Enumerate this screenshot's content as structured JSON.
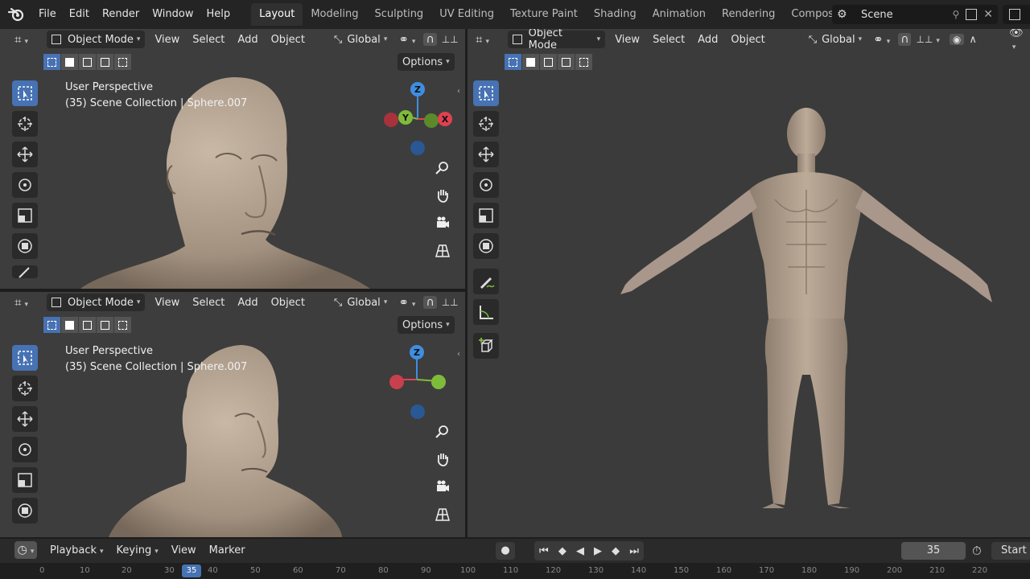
{
  "menubar": {
    "items": [
      "File",
      "Edit",
      "Render",
      "Window",
      "Help"
    ]
  },
  "workspaces": [
    "Layout",
    "Modeling",
    "Sculpting",
    "UV Editing",
    "Texture Paint",
    "Shading",
    "Animation",
    "Rendering",
    "Compositin"
  ],
  "active_workspace": "Layout",
  "scene": {
    "name": "Scene"
  },
  "viewport_header": {
    "mode": "Object Mode",
    "menus": [
      "View",
      "Select",
      "Add",
      "Object"
    ],
    "orientation": "Global",
    "options": "Options"
  },
  "viewports": [
    {
      "title": "User Perspective",
      "subtitle": "(35) Scene Collection | Sphere.007"
    },
    {
      "title": "User Perspective",
      "subtitle": "(35) Scene Collection | Sphere.007"
    }
  ],
  "gizmo": {
    "z": "Z",
    "y": "Y",
    "x": "X"
  },
  "timeline": {
    "menus": [
      "Playback",
      "Keying",
      "View",
      "Marker"
    ],
    "current_frame": "35",
    "start_label": "Start",
    "ruler_labels": [
      "0",
      "10",
      "20",
      "30",
      "35",
      "40",
      "50",
      "60",
      "70",
      "80",
      "90",
      "100",
      "110",
      "120",
      "130",
      "140",
      "150",
      "160",
      "170",
      "180",
      "190",
      "200",
      "210",
      "220"
    ]
  },
  "colors": {
    "accent": "#4772b3",
    "axis_x": "#e0414f",
    "axis_y": "#7fbb3a",
    "axis_z": "#3f8ee0",
    "skin": "#b7a593"
  }
}
